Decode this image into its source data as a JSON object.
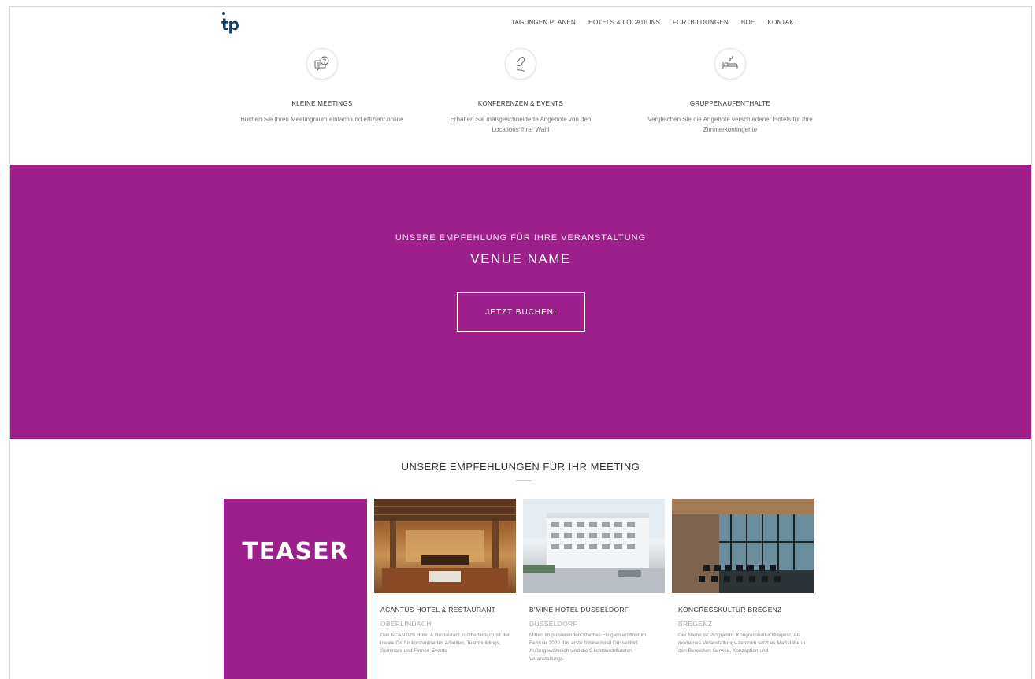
{
  "header": {
    "logo_text": "tp",
    "nav": [
      "TAGUNGEN PLANEN",
      "HOTELS & LOCATIONS",
      "FORTBILDUNGEN",
      "BOE",
      "KONTAKT"
    ]
  },
  "features": [
    {
      "icon": "chat-question-icon",
      "title": "KLEINE MEETINGS",
      "desc": "Buchen Sie Ihren Meetingraum einfach und effizient online"
    },
    {
      "icon": "microphone-icon",
      "title": "KONFERENZEN & EVENTS",
      "desc": "Erhalten Sie maßgeschneiderte Angebote von den Locations Ihrer Wahl"
    },
    {
      "icon": "bed-icon",
      "title": "GRUPPENAUFENTHALTE",
      "desc": "Vergleichen Sie die Angebote verschiedener Hotels für Ihre Zimmerkontingente"
    }
  ],
  "hero": {
    "subtitle": "UNSERE EMPFEHLUNG FÜR IHRE VERANSTALTUNG",
    "venue": "VENUE NAME",
    "button": "JETZT BUCHEN!"
  },
  "recommendations": {
    "title": "UNSERE EMPFEHLUNGEN FÜR IHR MEETING",
    "teaser": "TEASER",
    "cards": [
      {
        "name": "ACANTUS HOTEL & RESTAURANT",
        "city": "OBERLINDACH",
        "text": "Das ACANTUS Hotel & Restaurant in Oberlindach ist der ideale Ort für konzentriertes Arbeiten, Teambuildings, Seminare und Firmen-Events"
      },
      {
        "name": "B'MINE HOTEL DÜSSELDORF",
        "city": "DÜSSELDORF",
        "text": "Mitten im pulsierenden Stadtteil Flingern eröffnet im Februar 2020 das erste b'mine hotel Düsseldorf. Außergewöhnlich sind die 9 lichtdurchfluteten Veranstaltungs-"
      },
      {
        "name": "KONGRESSKULTUR BREGENZ",
        "city": "BREGENZ",
        "text": "Der Name ist Programm: Kongresskultur Bregenz. Als modernes Veranstaltungs-zentrum setzt es Maßstäbe in den Bereichen Service, Konzeption und"
      }
    ]
  },
  "colors": {
    "accent": "#9d1f8b",
    "logo": "#123a6b"
  }
}
